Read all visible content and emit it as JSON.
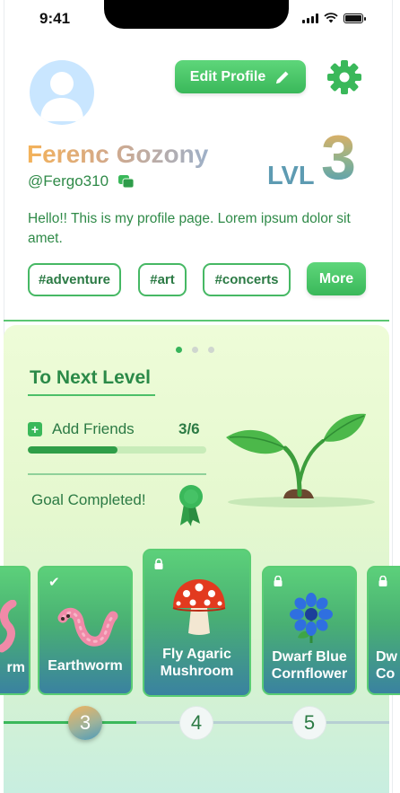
{
  "status_bar": {
    "time": "9:41"
  },
  "profile": {
    "edit_label": "Edit Profile",
    "name": "Ferenc Gozony",
    "handle": "@Fergo310",
    "level_label": "LVL",
    "level_value": "3",
    "bio": "Hello!! This is my profile page. Lorem ipsum dolor sit amet.",
    "tags": [
      "#adventure",
      "#art",
      "#concerts"
    ],
    "more_label": "More"
  },
  "carousel": {
    "pages": 3,
    "active_page": 1
  },
  "next_level": {
    "title": "To Next Level",
    "task": {
      "label": "Add Friends",
      "count": "3/6",
      "progress": 0.5
    },
    "goal_text": "Goal Completed!"
  },
  "cards": [
    {
      "label": "rm",
      "state": "unlocked"
    },
    {
      "label": "Earthworm",
      "state": "unlocked",
      "icon": "check-icon"
    },
    {
      "label": "Fly Agaric Mushroom",
      "line1": "Fly Agaric",
      "line2": "Mushroom",
      "state": "locked"
    },
    {
      "label": "Dwarf Blue Cornflower",
      "line1": "Dwarf Blue",
      "line2": "Cornflower",
      "state": "locked"
    },
    {
      "label": "Dw Co",
      "line1": "Dw",
      "line2": "Co",
      "state": "locked"
    }
  ],
  "level_track": {
    "current": "3",
    "next": [
      "4",
      "5"
    ]
  },
  "colors": {
    "accent": "#3ab85a",
    "text_green": "#2b7a44",
    "level_blue": "#5e9bb2"
  }
}
